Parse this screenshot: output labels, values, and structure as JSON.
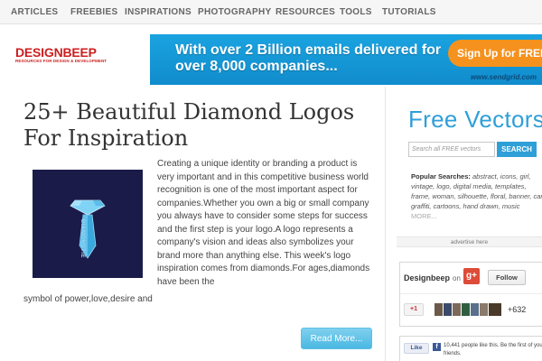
{
  "nav": {
    "items": [
      "ARTICLES",
      "FREEBIES",
      "INSPIRATIONS",
      "PHOTOGRAPHY",
      "RESOURCES",
      "TOOLS",
      "TUTORIALS"
    ]
  },
  "logo": {
    "name": "DESIGNBEEP",
    "tagline": "RESOURCES FOR DESIGN & DEVELOPMENT"
  },
  "ad": {
    "line1": "With over 2 Billion emails delivered for",
    "line2": "over 8,000 companies...",
    "cta": "Sign Up for FREE",
    "url": "www.sendgrid.com"
  },
  "article": {
    "title": "25+ Beautiful Diamond Logos For Inspiration",
    "thumbnail_text": "DIAMONDTIE",
    "body": "Creating a unique identity or branding a product is very important and in this competitive business world recognition is one of the most important aspect for companies.Whether you own a big or small company you always have to consider some steps for success and the first step is your logo.A logo represents a company's vision and ideas also symbolizes your brand more than anything else. This week's logo inspiration comes from diamonds.For ages,diamonds have been the",
    "body_tail": "symbol of power,love,desire and",
    "read_more": "Read More..."
  },
  "sidebar": {
    "free_vectors": {
      "title_part1": "Free",
      "title_part2": "Vectors",
      "search_placeholder": "Search all FREE vectors",
      "search_button": "SEARCH",
      "popular_label": "Popular Searches:",
      "popular_terms": "abstract, icons, girl, vintage, logo, digital media, templates, frame, woman, silhouette, floral, banner, car, graffiti, cartoons, hand drawn, music",
      "more": "MORE..."
    },
    "ad_label": "advertise here",
    "gplus": {
      "name": "Designbeep",
      "on": "on",
      "icon": "g+",
      "follow": "Follow",
      "plusone": "+1",
      "count": "+632",
      "avatar_colors": [
        "#6b5a4a",
        "#3a4a6b",
        "#7a6a5a",
        "#2f5f3f",
        "#5a6f8a",
        "#8a7a6a",
        "#4a3a2a"
      ]
    },
    "facebook": {
      "like": "Like",
      "icon": "f",
      "text": "10,441 people like this. Be the first of your friends."
    }
  },
  "colors": {
    "accent_blue": "#2f9fd8",
    "logo_red": "#cc1f1f",
    "ad_orange": "#f5921e",
    "thumb_bg": "#1b1b49"
  }
}
